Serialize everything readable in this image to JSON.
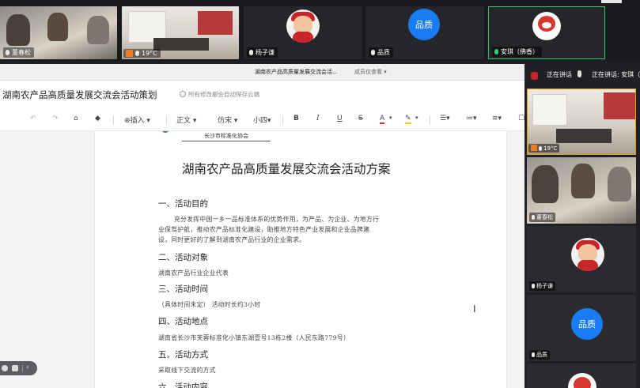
{
  "top_tiles": [
    {
      "name": "董春松",
      "mic": "white"
    },
    {
      "name": "19°C",
      "mic": "white",
      "badge": "orange"
    },
    {
      "name": "杨子谦",
      "mic": "white"
    },
    {
      "name": "品质",
      "avatar_text": "品质",
      "mic": "white"
    },
    {
      "name": "安琪（佛香）",
      "mic": "green"
    }
  ],
  "titlebar": {
    "title": "湖南农产品高质量发展交流会活...",
    "mode": "成员仅查看 ▾"
  },
  "doc": {
    "title": "湖南农产品高质量发展交流会活动策划",
    "save_status": "所有修改都会自动保存云端"
  },
  "toolbar": {
    "insert": "插入",
    "style": "正文",
    "font": "仿宋",
    "size": "小四",
    "bold": "B",
    "italic": "I",
    "underline": "U",
    "strike": "S",
    "color": "A",
    "highlight": "✎"
  },
  "page": {
    "org": "长沙市标准化协会",
    "heading": "湖南农产品高质量发展交流会活动方案",
    "sec1_title": "一、活动目的",
    "sec1_line1": "充分发挥中国一乡一品标准体系的优势作用，为产品、为企业、为地方行",
    "sec1_line2": "业保驾护航，推动农产品标准化建设，助推地方特色产业发展和企业品牌建",
    "sec1_line3": "设，同时更好的了解到湖南农产品行业的企业需求。",
    "sec2_title": "二、活动对象",
    "sec2_body": "湖南农产品行业企业代表",
    "sec3_title": "三、活动时间",
    "sec3_body": "（具体时间未定） 活动时长约3小时",
    "sec4_title": "四、活动地点",
    "sec4_body": "湖南省长沙市芙蓉标准化小镇东湖壹号13栋2楼（人民东路779号）",
    "sec5_title": "五、活动方式",
    "sec5_body": "采取线下交流的方式",
    "sec6_title": "六、活动内容"
  },
  "right_panel": {
    "speaking_left": "正在讲话",
    "speaking_right": "正在讲话: 安琪（",
    "tiles": [
      {
        "name": "19°C"
      },
      {
        "name": "董春松"
      },
      {
        "name": "杨子谦"
      },
      {
        "name": "品质",
        "avatar_text": "品质"
      }
    ]
  },
  "colors": {
    "accent_blue": "#1a7cf5",
    "dark_bg": "#1f2023",
    "orange_badge": "#f07a1e"
  }
}
